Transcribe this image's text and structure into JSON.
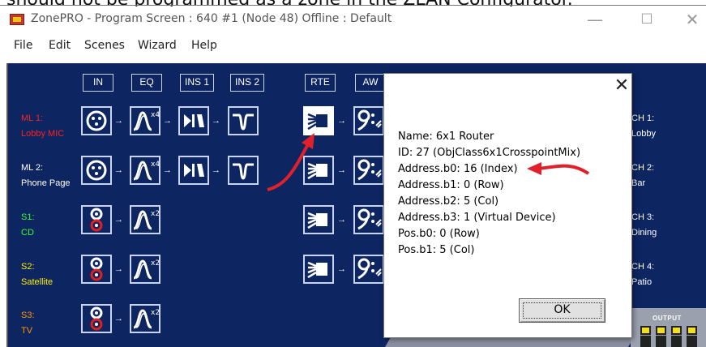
{
  "caption": "should not be programmed as a zone in the ZLAN Configurator.",
  "window": {
    "title": "ZonePRO - Program Screen  :  640 #1 (Node 48) Offline : Default",
    "minimize_glyph": "—",
    "maximize_glyph": "☐",
    "close_glyph": "✕"
  },
  "menu": [
    "File",
    "Edit",
    "Scenes",
    "Wizard",
    "Help"
  ],
  "column_headers": [
    "IN",
    "EQ",
    "INS 1",
    "INS 2",
    "RTE",
    "AW"
  ],
  "inputs": [
    {
      "line1": "ML 1:",
      "line2": "Lobby MIC",
      "color": "#ff2020"
    },
    {
      "line1": "ML 2:",
      "line2": "Phone Page",
      "color": "#ffffff"
    },
    {
      "line1": "S1:",
      "line2": "CD",
      "color": "#33ff33"
    },
    {
      "line1": "S2:",
      "line2": "Satellite",
      "color": "#ffee00"
    },
    {
      "line1": "S3:",
      "line2": "TV",
      "color": "#ff9900"
    }
  ],
  "outputs": [
    {
      "line1": "CH 1:",
      "line2": "Lobby"
    },
    {
      "line1": "CH 2:",
      "line2": "Bar"
    },
    {
      "line1": "CH 3:",
      "line2": "Dining"
    },
    {
      "line1": "CH 4:",
      "line2": "Patio"
    }
  ],
  "eq_multipliers": [
    "x4",
    "x4",
    "x2",
    "x2",
    "x2"
  ],
  "output_panel_label": "OUTPUT",
  "dialog": {
    "close_glyph": "✕",
    "lines": [
      "Name: 6x1 Router",
      "ID: 27 (ObjClass6x1CrosspointMix)",
      "Address.b0: 16 (Index)",
      "Address.b1: 0 (Row)",
      "Address.b2: 5 (Col)",
      "Address.b3: 1 (Virtual Device)",
      "Pos.b0: 0 (Row)",
      "Pos.b1: 5 (Col)"
    ],
    "ok_label": "OK"
  },
  "colors": {
    "canvas": "#0d2561",
    "annotation_arrow": "#e0202a"
  },
  "icons": {
    "input_xlr": "xlr-connector-icon",
    "input_rca": "rca-connector-icon",
    "eq": "eq-curve-icon",
    "ins1": "compressor-icon",
    "ins2": "filter-icon",
    "router": "router-icon",
    "ambient": "ambient-noise-icon"
  }
}
